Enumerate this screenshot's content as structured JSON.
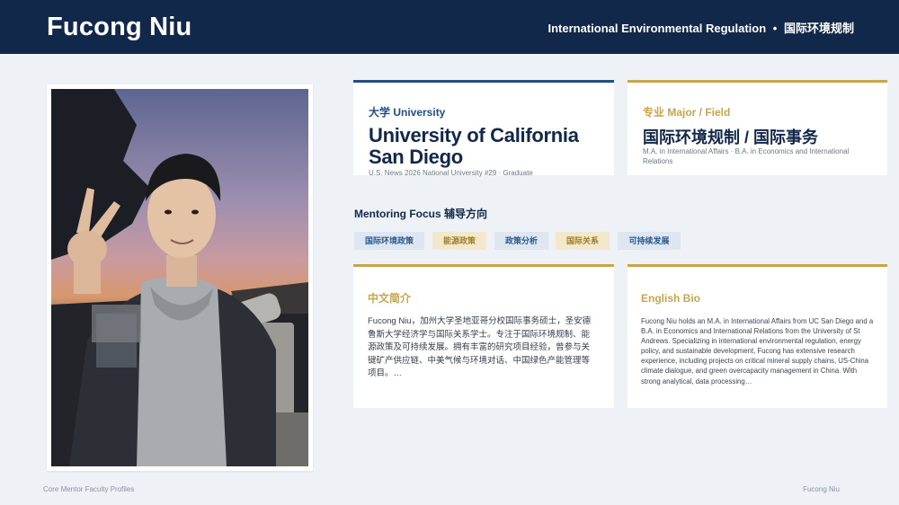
{
  "header": {
    "name": "Fucong Niu",
    "subtitle_en": "International Environmental Regulation",
    "subtitle_sep": "•",
    "subtitle_cn": "国际环境规制"
  },
  "university": {
    "label": "大学 University",
    "name": "University of California San Diego",
    "meta": "U.S. News 2026 National University #29 · Graduate"
  },
  "major": {
    "label": "专业 Major / Field",
    "name": "国际环境规制 / 国际事务",
    "meta": "M.A. in International Affairs · B.A. in Economics and International Relations"
  },
  "focus": {
    "title": "Mentoring Focus 辅导方向",
    "tags": [
      {
        "label": "国际环境政策",
        "style": "blue"
      },
      {
        "label": "能源政策",
        "style": "gold"
      },
      {
        "label": "政策分析",
        "style": "blue"
      },
      {
        "label": "国际关系",
        "style": "gold"
      },
      {
        "label": "可持续发展",
        "style": "blue"
      }
    ]
  },
  "bio_cn": {
    "label": "中文简介",
    "text": "Fucong Niu，加州大学圣地亚哥分校国际事务硕士，圣安德鲁斯大学经济学与国际关系学士。专注于国际环境规制、能源政策及可持续发展。拥有丰富的研究项目经验，曾参与关键矿产供应链、中美气候与环境对话、中国绿色产能管理等项目。…"
  },
  "bio_en": {
    "label": "English Bio",
    "text": "Fucong Niu holds an M.A. in International Affairs from UC San Diego and a B.A. in Economics and International Relations from the University of St Andrews. Specializing in international environmental regulation, energy policy, and sustainable development, Fucong has extensive research experience, including projects on critical mineral supply chains, US-China climate dialogue, and green overcapacity management in China. With strong analytical, data processing…"
  },
  "footer": {
    "left": "Core Mentor Faculty Profiles",
    "right": "Fucong Niu"
  },
  "colors": {
    "header_bg": "#12284a",
    "accent_blue": "#1f4f86",
    "accent_gold": "#c9a54a",
    "page_bg": "#eef1f5"
  }
}
